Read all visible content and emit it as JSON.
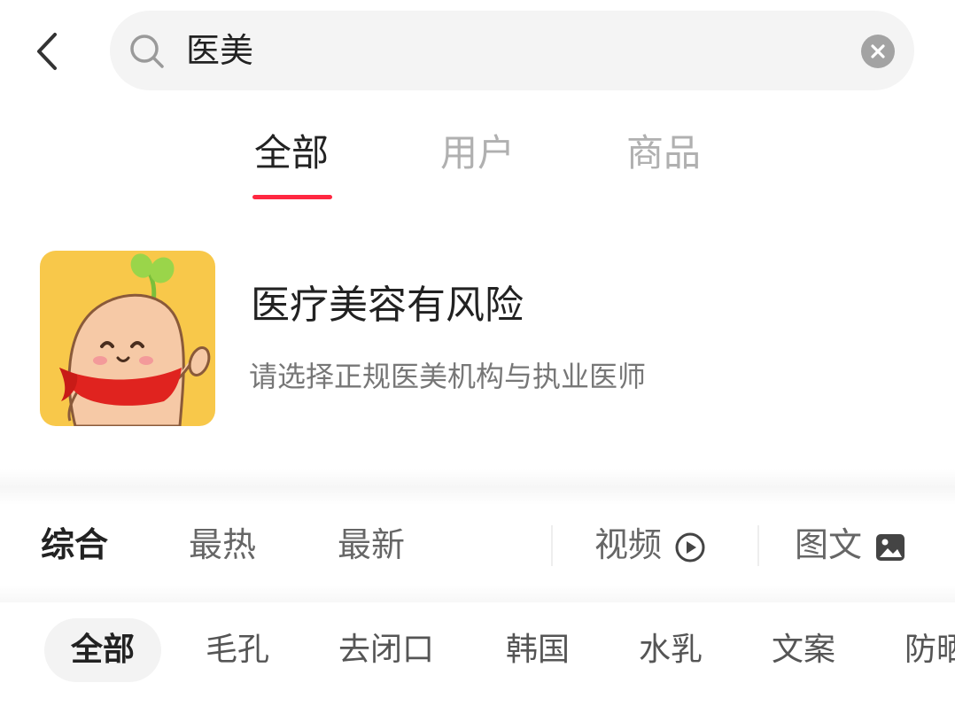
{
  "header": {
    "search_query": "医美"
  },
  "tabs": [
    {
      "label": "全部",
      "active": true
    },
    {
      "label": "用户",
      "active": false
    },
    {
      "label": "商品",
      "active": false
    }
  ],
  "banner": {
    "title": "医疗美容有风险",
    "subtitle": "请选择正规医美机构与执业医师"
  },
  "sort_bar": {
    "items": [
      "综合",
      "最热",
      "最新"
    ],
    "video_label": "视频",
    "image_text_label": "图文"
  },
  "filter_chips": [
    "全部",
    "毛孔",
    "去闭口",
    "韩国",
    "水乳",
    "文案",
    "防晒"
  ],
  "colors": {
    "accent": "#ff2741",
    "mascot_bg": "#f8c84a",
    "scarf": "#e0231f"
  },
  "icons": [
    "back-arrow-icon",
    "search-icon",
    "clear-icon",
    "play-circle-icon",
    "image-icon"
  ]
}
